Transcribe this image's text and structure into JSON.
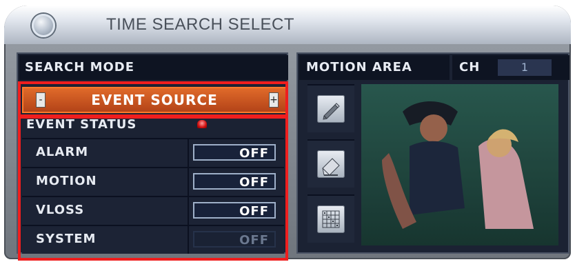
{
  "title": "TIME SEARCH SELECT",
  "left_panel": {
    "header": "SEARCH MODE",
    "event_source": {
      "label": "EVENT SOURCE",
      "left_arrow": "-",
      "right_arrow": "+"
    },
    "event_status_label": "EVENT STATUS",
    "rows": [
      {
        "name": "ALARM",
        "value": "OFF"
      },
      {
        "name": "MOTION",
        "value": "OFF"
      },
      {
        "name": "VLOSS",
        "value": "OFF"
      },
      {
        "name": "SYSTEM",
        "value": "OFF"
      }
    ]
  },
  "right_panel": {
    "header": "MOTION AREA",
    "ch_label": "CH",
    "ch_value": "1",
    "tools": [
      {
        "icon": "pencil-icon"
      },
      {
        "icon": "eraser-icon"
      },
      {
        "icon": "grid-icon"
      }
    ]
  },
  "colors": {
    "panel": "#1b2233",
    "highlight": "#ef1e1e",
    "selected": "#d45a24"
  }
}
